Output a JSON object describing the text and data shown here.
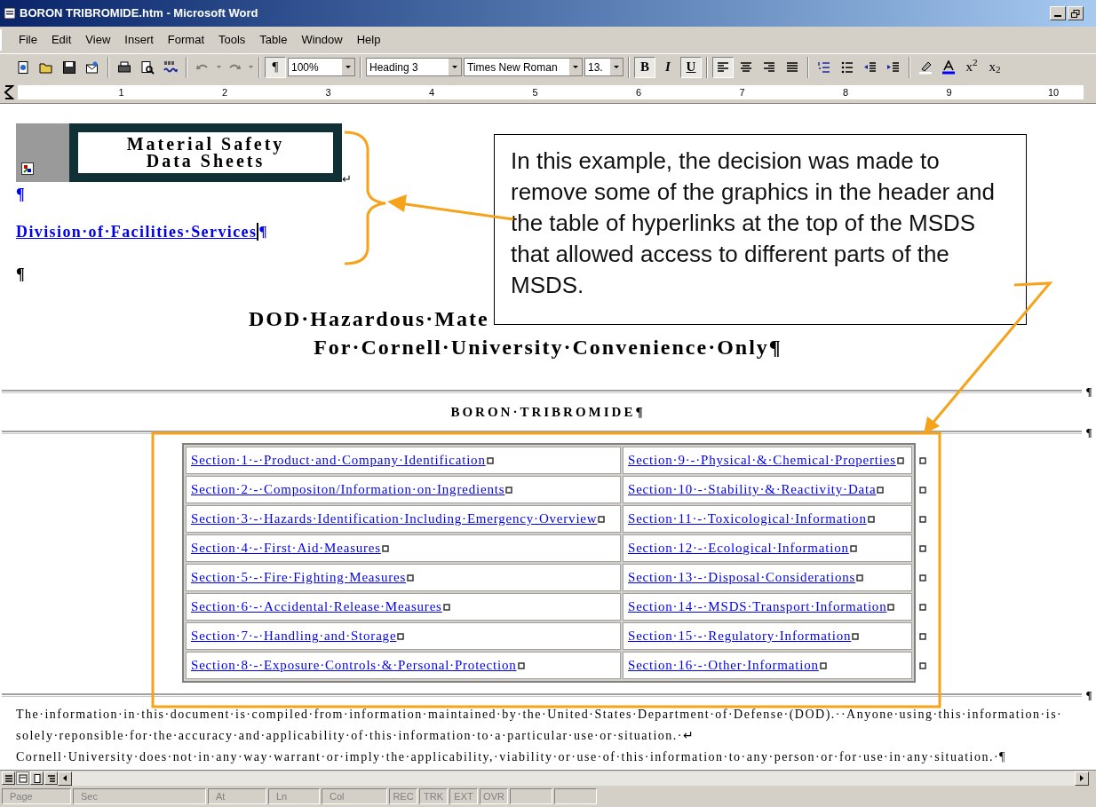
{
  "window": {
    "title": "BORON TRIBROMIDE.htm - Microsoft Word"
  },
  "menu": [
    "File",
    "Edit",
    "View",
    "Insert",
    "Format",
    "Tools",
    "Table",
    "Window",
    "Help"
  ],
  "toolbar": [
    {
      "kind": "button",
      "pressed": false,
      "disabled": false
    },
    {
      "kind": "button",
      "pressed": false,
      "disabled": false
    },
    {
      "kind": "button",
      "pressed": false,
      "disabled": false
    },
    {
      "kind": "button",
      "pressed": false,
      "disabled": false
    },
    {
      "kind": "separator"
    },
    {
      "kind": "button",
      "pressed": false,
      "disabled": false
    },
    {
      "kind": "button",
      "pressed": false,
      "disabled": false
    },
    {
      "kind": "button",
      "pressed": false,
      "disabled": false
    },
    {
      "kind": "separator"
    },
    {
      "kind": "button",
      "pressed": false,
      "disabled": true
    },
    {
      "kind": "button",
      "pressed": false,
      "disabled": true
    },
    {
      "kind": "separator"
    },
    {
      "kind": "text_button",
      "label": "¶",
      "pressed": true
    },
    {
      "kind": "dropdown",
      "value": "100%"
    },
    {
      "kind": "separator"
    },
    {
      "kind": "dropdown",
      "value": "Heading 3"
    },
    {
      "kind": "dropdown",
      "value": "Times New Roman"
    },
    {
      "kind": "dropdown",
      "value": "13."
    },
    {
      "kind": "separator"
    },
    {
      "kind": "text_button",
      "label": "B",
      "pressed": true
    },
    {
      "kind": "text_button",
      "label": "I",
      "pressed": false
    },
    {
      "kind": "text_button",
      "label": "U",
      "pressed": true
    },
    {
      "kind": "separator"
    },
    {
      "kind": "button",
      "pressed": true,
      "disabled": false
    },
    {
      "kind": "button",
      "pressed": false,
      "disabled": false
    },
    {
      "kind": "button",
      "pressed": false,
      "disabled": false
    },
    {
      "kind": "button",
      "pressed": false,
      "disabled": false
    },
    {
      "kind": "separator"
    },
    {
      "kind": "button",
      "pressed": false,
      "disabled": false
    },
    {
      "kind": "button",
      "pressed": false,
      "disabled": false
    },
    {
      "kind": "button",
      "pressed": false,
      "disabled": false
    },
    {
      "kind": "button",
      "pressed": false,
      "disabled": false
    },
    {
      "kind": "separator"
    },
    {
      "kind": "button",
      "pressed": false,
      "disabled": false
    },
    {
      "kind": "button",
      "pressed": false,
      "disabled": false
    },
    {
      "kind": "text_button",
      "label": "x$^{2}$",
      "pressed": false
    },
    {
      "kind": "text_button",
      "label": "x$_{2}$",
      "pressed": false
    }
  ],
  "ruler": [
    "1",
    "2",
    "3",
    "4",
    "5",
    "6",
    "7",
    "8",
    "9",
    "10"
  ],
  "document": {
    "banner": [
      "Material Safety",
      "Data Sheets"
    ],
    "banner_mark": "↵",
    "paragraph_mark_1": "¶",
    "division_link": "Division·of·Facilities·Services",
    "division_mark": "¶",
    "paragraph_mark_2": "¶",
    "title_lines": [
      "DOD·Hazardous·Mate",
      "For·Cornell·University·Convenience·Only¶"
    ],
    "rule_marks": [
      "¶",
      "¶",
      "¶"
    ],
    "subtitle": "BORON·TRIBROMIDE¶",
    "sections": [
      [
        "Section·1·-·Product·and·Company·Identification",
        "Section·9·-·Physical·&·Chemical·Properties"
      ],
      [
        "Section·2·-·Compositon/Information·on·Ingredients",
        "Section·10·-·Stability·&·Reactivity·Data"
      ],
      [
        "Section·3·-·Hazards·Identification·Including·Emergency·Overview",
        "Section·11·-·Toxicological·Information"
      ],
      [
        "Section·4·-·First·Aid·Measures",
        "Section·12·-·Ecological·Information"
      ],
      [
        "Section·5·-·Fire·Fighting·Measures",
        "Section·13·-·Disposal·Considerations"
      ],
      [
        "Section·6·-·Accidental·Release·Measures",
        "Section·14·-·MSDS·Transport·Information"
      ],
      [
        "Section·7·-·Handling·and·Storage",
        "Section·15·-·Regulatory·Information"
      ],
      [
        "Section·8·-·Exposure·Controls·&·Personal·Protection",
        "Section·16·-·Other·Information"
      ]
    ],
    "footer_lines": [
      "The·information·in·this·document·is·compiled·from·information·maintained·by·the·United·States·Department·of·Defense·(DOD).··Anyone·using·this·information·is·",
      "solely·reponsible·for·the·accuracy·and·applicability·of·this·information·to·a·particular·use·or·situation.·↵",
      "Cornell·University·does·not·in·any·way·warrant·or·imply·the·applicability,·viability·or·use·of·this·information·to·any·person·or·for·use·in·any·situation.·¶"
    ]
  },
  "callout": {
    "text": "In this example, the decision was made to remove some of the graphics in the header and the table of hyperlinks at the top of the MSDS that allowed access to different parts of the MSDS."
  },
  "status_bar": {
    "fields": [
      "Page",
      "Sec",
      "At",
      "Ln",
      "Col"
    ],
    "modes": [
      "REC",
      "TRK",
      "EXT",
      "OVR"
    ]
  }
}
